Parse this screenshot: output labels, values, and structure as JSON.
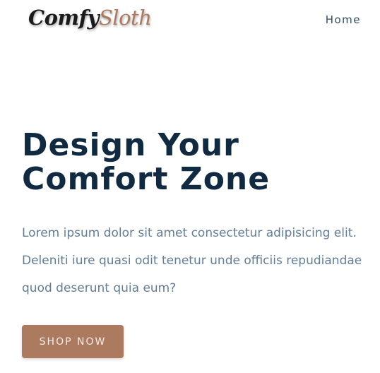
{
  "header": {
    "logo": {
      "part1": "Comfy",
      "part2": "Sloth"
    },
    "nav": {
      "home_label": "Home"
    }
  },
  "hero": {
    "title_line1": "Design Your",
    "title_line2": "Comfort Zone",
    "text_line1": "Lorem ipsum dolor sit amet consectetur adipisicing elit.",
    "text_line2": "Deleniti iure quasi odit tenetur unde officiis repudiandae",
    "text_line3": "quod deserunt quia eum?",
    "button_label": "SHOP NOW"
  },
  "colors": {
    "brand": "#ab7a5f",
    "heading": "#102a42",
    "body_text": "#617d98",
    "nav_text": "#324d67"
  }
}
